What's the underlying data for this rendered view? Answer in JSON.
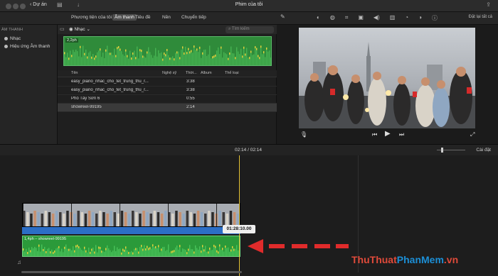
{
  "titlebar": {
    "back_label": "Dự án",
    "title": "Phim của tôi"
  },
  "toolbar": {
    "tabs": [
      "Phương tiện của tôi",
      "Âm thanh",
      "Tiêu đề",
      "Nền",
      "Chuyển tiếp"
    ],
    "active_tab": "Âm thanh",
    "reset_label": "Đặt lại tất cả",
    "tool_icons": [
      "color-balance-icon",
      "color-correction-icon",
      "crop-icon",
      "stabilization-icon",
      "volume-icon",
      "noise-reduction-icon",
      "speed-icon",
      "filter-icon",
      "info-icon"
    ]
  },
  "sidebar": {
    "heading": "ÂM THANH",
    "items": [
      {
        "label": "Nhạc",
        "icon": "music-icon"
      },
      {
        "label": "Hiệu ứng Âm thanh",
        "icon": "sound-effects-icon"
      }
    ]
  },
  "browser": {
    "source_label": "Nhạc",
    "search_placeholder": "Tìm kiếm",
    "waveform_duration": "2,2ph",
    "columns": [
      "Tên",
      "Nghệ sỹ",
      "Thời...",
      "Album",
      "Thể loại"
    ],
    "rows": [
      {
        "name": "easy_piano_nhac_cho_tet_trung_thu_r...",
        "artist": "",
        "time": "3:38",
        "album": "",
        "genre": ""
      },
      {
        "name": "easy_piano_nhac_cho_tet_trung_thu_r...",
        "artist": "",
        "time": "3:38",
        "album": "",
        "genre": ""
      },
      {
        "name": "Phố Tây Sơn 6",
        "artist": "",
        "time": "0:55",
        "album": "",
        "genre": ""
      },
      {
        "name": "showreel-99195",
        "artist": "",
        "time": "2:14",
        "album": "",
        "genre": "",
        "selected": true
      }
    ]
  },
  "timeline": {
    "current_time": "02:14",
    "total_time": "02:14",
    "settings_label": "Cài đặt",
    "tooltip_time": "01:28:10.00",
    "audio_clip_label": "1,4ph – showreel-99195"
  },
  "watermark": {
    "part1": "ThuThuat",
    "part2": "PhanMem",
    "part3": ".vn"
  },
  "colors": {
    "audio_green": "#2b9a3a",
    "video_blue": "#2c6ec6",
    "playhead": "#e3c234",
    "arrow_red": "#e02b2b"
  }
}
